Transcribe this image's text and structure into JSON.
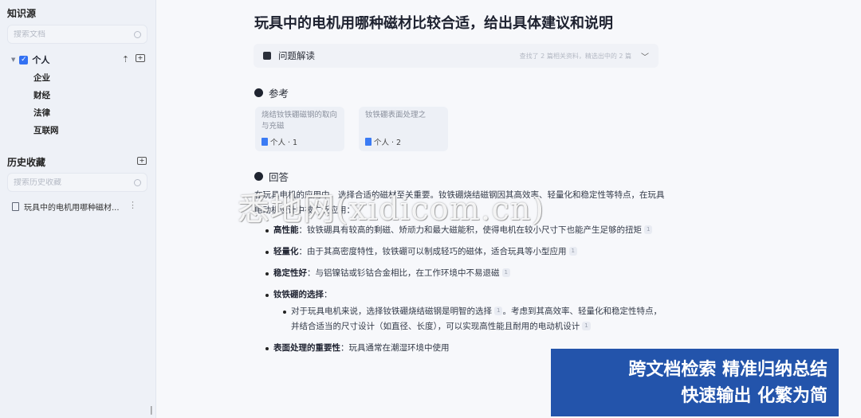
{
  "sidebar": {
    "knowledge_title": "知识源",
    "search_docs_placeholder": "搜索文档",
    "tree": {
      "root_label": "个人",
      "children": [
        "企业",
        "财经",
        "法律",
        "互联网"
      ]
    },
    "history_title": "历史收藏",
    "search_history_placeholder": "搜索历史收藏",
    "history_items": [
      "玩具中的电机用哪种磁材..."
    ],
    "icons": {
      "upload": "upload-icon",
      "new_folder": "new-folder-icon",
      "collapse": "collapse-sidebar-icon"
    }
  },
  "main": {
    "title": "玩具中的电机用哪种磁材比较合适，给出具体建议和说明",
    "analysis": {
      "label": "问题解读",
      "status": "查找了 2 篇相关资料，精选出中的 2 篇"
    },
    "references": {
      "heading": "参考",
      "cards": [
        {
          "title": "烧结钕铁硼磁钢的取向与充磁",
          "source": "个人 · 1"
        },
        {
          "title": "钕铁硼表面处理之",
          "source": "个人 · 2"
        }
      ]
    },
    "answer": {
      "heading": "回答",
      "intro": "在玩具电机的应用中，选择合适的磁材至关重要。钕铁硼烧结磁钢因其高效率、轻量化和稳定性等特点，在玩具电动机设计中被广泛应用：",
      "points": [
        {
          "label": "高性能",
          "text": "：钕铁硼具有较高的剩磁、矫顽力和最大磁能积，使得电机在较小尺寸下也能产生足够的扭矩",
          "cite": "1"
        },
        {
          "label": "轻量化",
          "text": "：由于其高密度特性，钕铁硼可以制成轻巧的磁体，适合玩具等小型应用",
          "cite": "1"
        },
        {
          "label": "稳定性好",
          "text": "：与铝镍钴或钐钴合金相比，在工作环境中不易退磁",
          "cite": "1"
        },
        {
          "label": "钕铁硼的选择",
          "text": "："
        }
      ],
      "sub_point": {
        "text_a": "对于玩具电机来说，选择钕铁硼烧结磁钢是明智的选择",
        "cite_a": "1",
        "text_b": "。考虑到其高效率、轻量化和稳定性特点，并结合适当的尺寸设计（如直径、长度），可以实现高性能且耐用的电动机设计",
        "cite_b": "1"
      },
      "last_point": {
        "label": "表面处理的重要性",
        "text": "：玩具通常在潮湿环境中使用"
      }
    }
  },
  "overlay": {
    "watermark": "悉地网(xidicom.cn)",
    "banner_line1": "跨文档检索  精准归纳总结",
    "banner_line2": "快速输出  化繁为简"
  },
  "colors": {
    "accent": "#3371f2",
    "banner": "#2354ab",
    "sidebar_bg": "#eef1f7"
  }
}
